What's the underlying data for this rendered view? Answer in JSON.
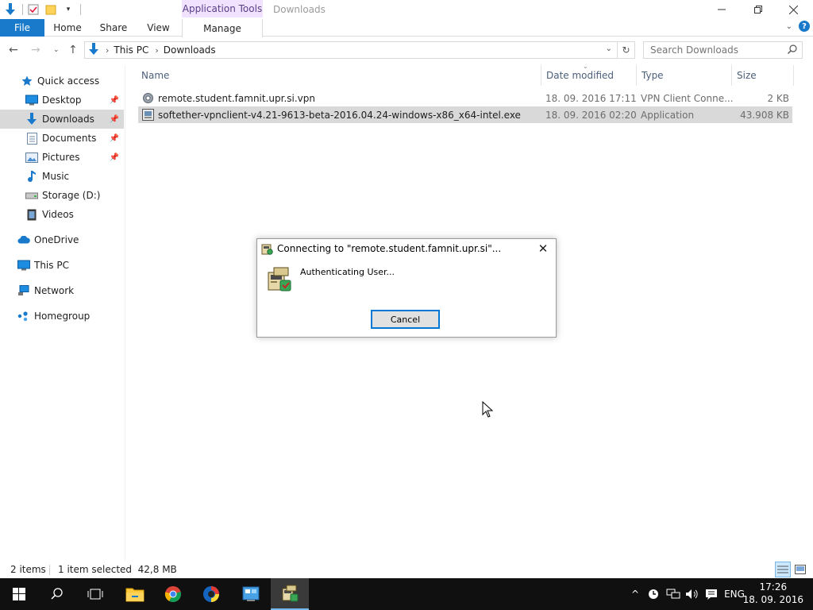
{
  "window": {
    "title": "Downloads",
    "context_tab_group": "Application Tools"
  },
  "ribbon": {
    "tabs": [
      {
        "label": "File"
      },
      {
        "label": "Home"
      },
      {
        "label": "Share"
      },
      {
        "label": "View"
      },
      {
        "label": "Manage"
      }
    ]
  },
  "address": {
    "crumbs": [
      "This PC",
      "Downloads"
    ]
  },
  "search": {
    "placeholder": "Search Downloads"
  },
  "sidebar": {
    "items": [
      {
        "label": "Quick access",
        "icon": "star-icon"
      },
      {
        "label": "Desktop",
        "icon": "desktop-icon",
        "pinned": true
      },
      {
        "label": "Downloads",
        "icon": "download-arrow-icon",
        "pinned": true,
        "selected": true
      },
      {
        "label": "Documents",
        "icon": "documents-icon",
        "pinned": true
      },
      {
        "label": "Pictures",
        "icon": "pictures-icon",
        "pinned": true
      },
      {
        "label": "Music",
        "icon": "music-note-icon"
      },
      {
        "label": "Storage (D:)",
        "icon": "drive-icon"
      },
      {
        "label": "Videos",
        "icon": "videos-icon"
      },
      {
        "label": "OneDrive",
        "icon": "cloud-icon"
      },
      {
        "label": "This PC",
        "icon": "computer-icon"
      },
      {
        "label": "Network",
        "icon": "network-icon"
      },
      {
        "label": "Homegroup",
        "icon": "homegroup-icon"
      }
    ]
  },
  "filelist": {
    "columns": [
      "Name",
      "Date modified",
      "Type",
      "Size"
    ],
    "rows": [
      {
        "name": "remote.student.famnit.upr.si.vpn",
        "date": "18. 09. 2016 17:11",
        "type": "VPN Client Conne...",
        "size": "2 KB",
        "icon": "gear-icon",
        "selected": false
      },
      {
        "name": "softether-vpnclient-v4.21-9613-beta-2016.04.24-windows-x86_x64-intel.exe",
        "date": "18. 09. 2016 02:20",
        "type": "Application",
        "size": "43.908 KB",
        "icon": "installer-icon",
        "selected": true
      }
    ]
  },
  "status": {
    "count": "2 items",
    "selection": "1 item selected  42,8 MB"
  },
  "dialog": {
    "title": "Connecting to \"remote.student.famnit.upr.si\"...",
    "message": "Authenticating User...",
    "cancel_label": "Cancel"
  },
  "taskbar": {
    "language": "ENG",
    "time": "17:26",
    "date": "18. 09. 2016"
  },
  "colors": {
    "accent": "#1979ca",
    "context_tab": "#f1e3ff",
    "selection": "#d9d9d9",
    "taskbar": "#101010"
  }
}
